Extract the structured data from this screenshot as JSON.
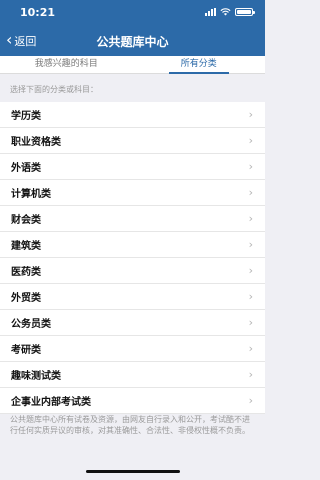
{
  "status_bar": {
    "time": "10:21"
  },
  "nav": {
    "back_label": "返回",
    "title": "公共题库中心"
  },
  "tabs": [
    {
      "label": "我感兴趣的科目",
      "active": false
    },
    {
      "label": "所有分类",
      "active": true
    }
  ],
  "hint": "选择下面的分类或科目：",
  "categories": [
    "学历类",
    "职业资格类",
    "外语类",
    "计算机类",
    "财会类",
    "建筑类",
    "医药类",
    "外贸类",
    "公务员类",
    "考研类",
    "趣味测试类",
    "企事业内部考试类"
  ],
  "footer": "公共题库中心所有试卷及资源，由网友自行录入和公开，考试酷不进行任何实质异议的审核，对其准确性、合法性、非侵权性概不负责。",
  "colors": {
    "accent": "#2c6aa8",
    "background": "#efeff4"
  },
  "icons": {
    "back": "chevron-left-icon",
    "row": "chevron-right-icon"
  }
}
